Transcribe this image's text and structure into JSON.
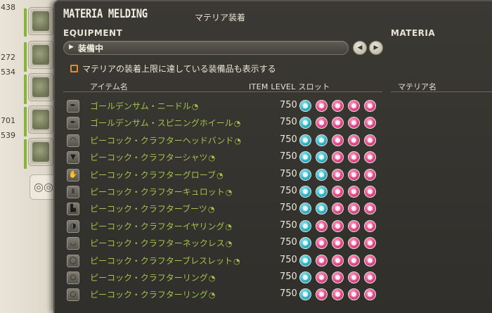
{
  "background": {
    "numbers": [
      "438",
      "272",
      "534",
      "701",
      "539"
    ],
    "accent_green": "#86b339"
  },
  "window": {
    "title_en": "MATERIA MELDING",
    "title_jp": "マテリア装着",
    "section_equipment": "EQUIPMENT",
    "section_materia": "MATERIA",
    "dropdown_value": "装備中",
    "checkbox_label": "マテリアの装着上限に達している装備品も表示する",
    "checkbox_color": "#e58a2c",
    "columns": {
      "item_name": "アイテム名",
      "item_level_slots": "ITEM LEVEL スロット",
      "materia_name": "マテリア名"
    }
  },
  "items": [
    {
      "name": "ゴールデンサム・ニードル",
      "ilvl": "750",
      "icon": "needle-icon",
      "slots": [
        "blue",
        "pink",
        "pink",
        "pink",
        "pink"
      ]
    },
    {
      "name": "ゴールデンサム・スピニングホイール",
      "ilvl": "750",
      "icon": "spinning-wheel-icon",
      "slots": [
        "blue",
        "pink",
        "pink",
        "pink",
        "pink"
      ]
    },
    {
      "name": "ピーコック・クラフターヘッドバンド",
      "ilvl": "750",
      "icon": "headband-icon",
      "slots": [
        "blue",
        "blue",
        "pink",
        "pink",
        "pink"
      ]
    },
    {
      "name": "ピーコック・クラフターシャツ",
      "ilvl": "750",
      "icon": "shirt-icon",
      "slots": [
        "blue",
        "blue",
        "pink",
        "pink",
        "pink"
      ]
    },
    {
      "name": "ピーコック・クラフターグローブ",
      "ilvl": "750",
      "icon": "glove-icon",
      "slots": [
        "blue",
        "blue",
        "pink",
        "pink",
        "pink"
      ]
    },
    {
      "name": "ピーコック・クラフターキュロット",
      "ilvl": "750",
      "icon": "trousers-icon",
      "slots": [
        "blue",
        "blue",
        "pink",
        "pink",
        "pink"
      ]
    },
    {
      "name": "ピーコック・クラフターブーツ",
      "ilvl": "750",
      "icon": "boots-icon",
      "slots": [
        "blue",
        "blue",
        "pink",
        "pink",
        "pink"
      ]
    },
    {
      "name": "ピーコック・クラフターイヤリング",
      "ilvl": "750",
      "icon": "earring-icon",
      "slots": [
        "blue",
        "pink",
        "pink",
        "pink",
        "pink"
      ]
    },
    {
      "name": "ピーコック・クラフターネックレス",
      "ilvl": "750",
      "icon": "necklace-icon",
      "slots": [
        "blue",
        "pink",
        "pink",
        "pink",
        "pink"
      ]
    },
    {
      "name": "ピーコック・クラフターブレスレット",
      "ilvl": "750",
      "icon": "bracelet-icon",
      "slots": [
        "blue",
        "pink",
        "pink",
        "pink",
        "pink"
      ]
    },
    {
      "name": "ピーコック・クラフターリング",
      "ilvl": "750",
      "icon": "ring-icon",
      "slots": [
        "blue",
        "pink",
        "pink",
        "pink",
        "pink"
      ]
    },
    {
      "name": "ピーコック・クラフターリング",
      "ilvl": "750",
      "icon": "ring-icon",
      "slots": [
        "blue",
        "pink",
        "pink",
        "pink",
        "pink"
      ]
    }
  ],
  "colors": {
    "item_name_green": "#a6c24c",
    "materia_blue": "#2fb6cc",
    "materia_pink": "#e34a8a"
  }
}
